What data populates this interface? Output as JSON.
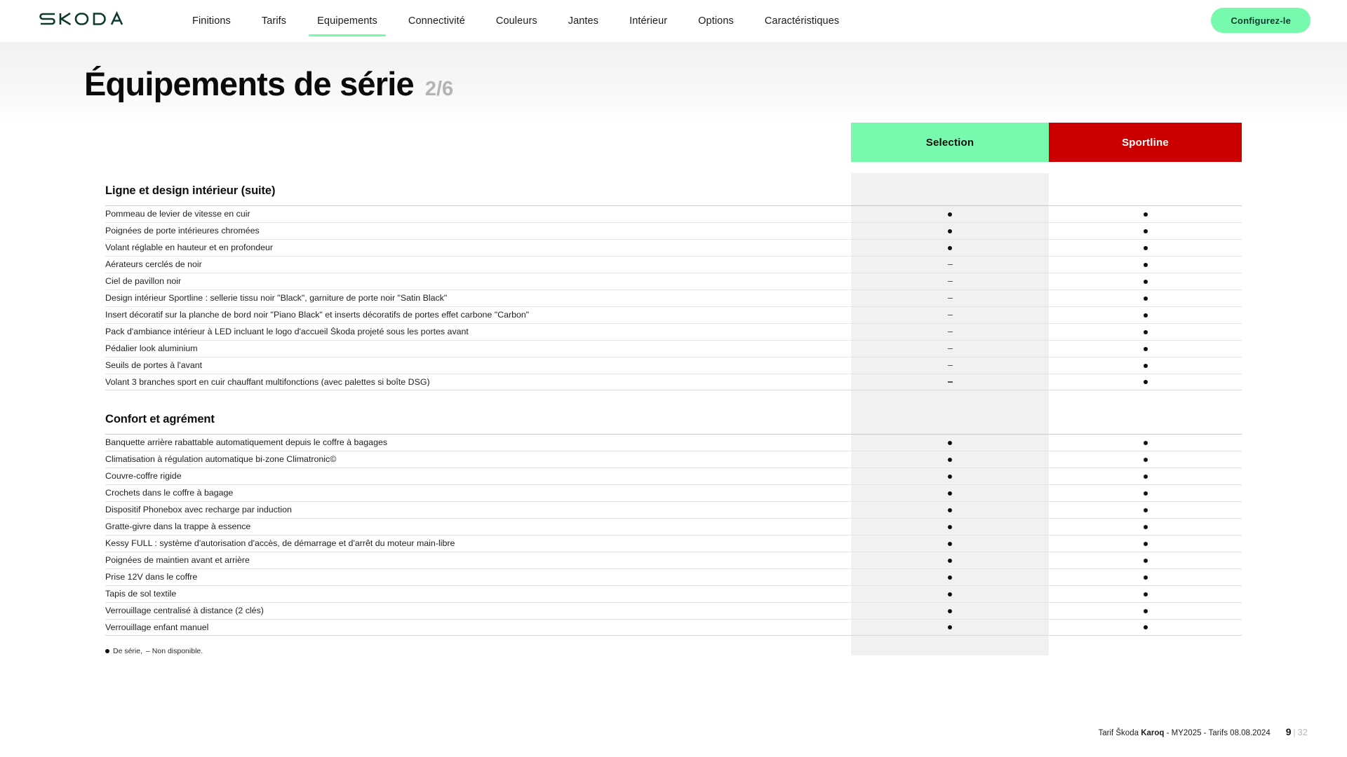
{
  "brand": {
    "logo_text": "ŠKODA",
    "logo_color": "#0e3a2f"
  },
  "nav": {
    "items": [
      {
        "label": "Finitions",
        "active": false
      },
      {
        "label": "Tarifs",
        "active": false
      },
      {
        "label": "Equipements",
        "active": true
      },
      {
        "label": "Connectivité",
        "active": false
      },
      {
        "label": "Couleurs",
        "active": false
      },
      {
        "label": "Jantes",
        "active": false
      },
      {
        "label": "Intérieur",
        "active": false
      },
      {
        "label": "Options",
        "active": false
      },
      {
        "label": "Caractéristiques",
        "active": false
      }
    ],
    "cta_label": "Configurez-le",
    "cta_color": "#78faae",
    "active_underline_color": "#78faae"
  },
  "hero": {
    "title": "Équipements de série",
    "counter": "2/6"
  },
  "table": {
    "columns": [
      {
        "label": "Selection",
        "bg": "#78faae",
        "fg": "#0d0d0d"
      },
      {
        "label": "Sportline",
        "bg": "#cc0000",
        "fg": "#ffffff"
      }
    ],
    "sections": [
      {
        "title": "Ligne et design intérieur (suite)",
        "rows": [
          {
            "label": "Pommeau de levier de vitesse en cuir",
            "selection": "dot",
            "sportline": "dot"
          },
          {
            "label": "Poignées de porte intérieures chromées",
            "selection": "dot",
            "sportline": "dot"
          },
          {
            "label": "Volant réglable en hauteur et en profondeur",
            "selection": "dot",
            "sportline": "dot"
          },
          {
            "label": "Aérateurs cerclés de noir",
            "selection": "dash",
            "sportline": "dot"
          },
          {
            "label": "Ciel de pavillon noir",
            "selection": "dash",
            "sportline": "dot"
          },
          {
            "label": "Design intérieur Sportline : sellerie tissu noir \"Black\", garniture de porte noir \"Satin Black\"",
            "selection": "dash",
            "sportline": "dot"
          },
          {
            "label": "Insert décoratif sur la planche de bord noir \"Piano Black\" et inserts décoratifs de portes effet carbone \"Carbon\"",
            "selection": "dash",
            "sportline": "dot"
          },
          {
            "label": "Pack d'ambiance intérieur à LED incluant le logo d'accueil Škoda projeté sous les portes avant",
            "selection": "dash",
            "sportline": "dot"
          },
          {
            "label": "Pédalier look aluminium",
            "selection": "dash",
            "sportline": "dot"
          },
          {
            "label": "Seuils de portes à l'avant",
            "selection": "dash",
            "sportline": "dot"
          },
          {
            "label": "Volant 3 branches sport en cuir chauffant multifonctions (avec palettes si boîte DSG)",
            "selection": "dash",
            "sportline": "dot"
          }
        ]
      },
      {
        "title": "Confort et agrément",
        "rows": [
          {
            "label": "Banquette arrière rabattable automatiquement depuis le coffre à bagages",
            "selection": "dot",
            "sportline": "dot"
          },
          {
            "label": "Climatisation à régulation automatique bi-zone Climatronic©",
            "selection": "dot",
            "sportline": "dot"
          },
          {
            "label": "Couvre-coffre rigide",
            "selection": "dot",
            "sportline": "dot"
          },
          {
            "label": "Crochets dans le coffre à bagage",
            "selection": "dot",
            "sportline": "dot"
          },
          {
            "label": "Dispositif Phonebox avec recharge par induction",
            "selection": "dot",
            "sportline": "dot"
          },
          {
            "label": "Gratte-givre dans la trappe à essence",
            "selection": "dot",
            "sportline": "dot"
          },
          {
            "label": "Kessy FULL : système d'autorisation d'accès, de démarrage et d'arrêt du moteur main-libre",
            "selection": "dot",
            "sportline": "dot"
          },
          {
            "label": "Poignées de maintien avant et arrière",
            "selection": "dot",
            "sportline": "dot"
          },
          {
            "label": "Prise 12V dans le coffre",
            "selection": "dot",
            "sportline": "dot"
          },
          {
            "label": "Tapis de sol textile",
            "selection": "dot",
            "sportline": "dot"
          },
          {
            "label": "Verrouillage centralisé à distance (2 clés)",
            "selection": "dot",
            "sportline": "dot"
          },
          {
            "label": "Verrouillage enfant manuel",
            "selection": "dot",
            "sportline": "dot"
          }
        ]
      }
    ],
    "legend": {
      "serie_label": "De série,",
      "unavailable_label": "– Non disponible."
    }
  },
  "footer": {
    "text_prefix": "Tarif Škoda ",
    "model": "Karoq",
    "text_suffix": " - MY2025 - Tarifs 08.08.2024",
    "page_current": "9",
    "page_separator": "|",
    "page_total": "32"
  }
}
